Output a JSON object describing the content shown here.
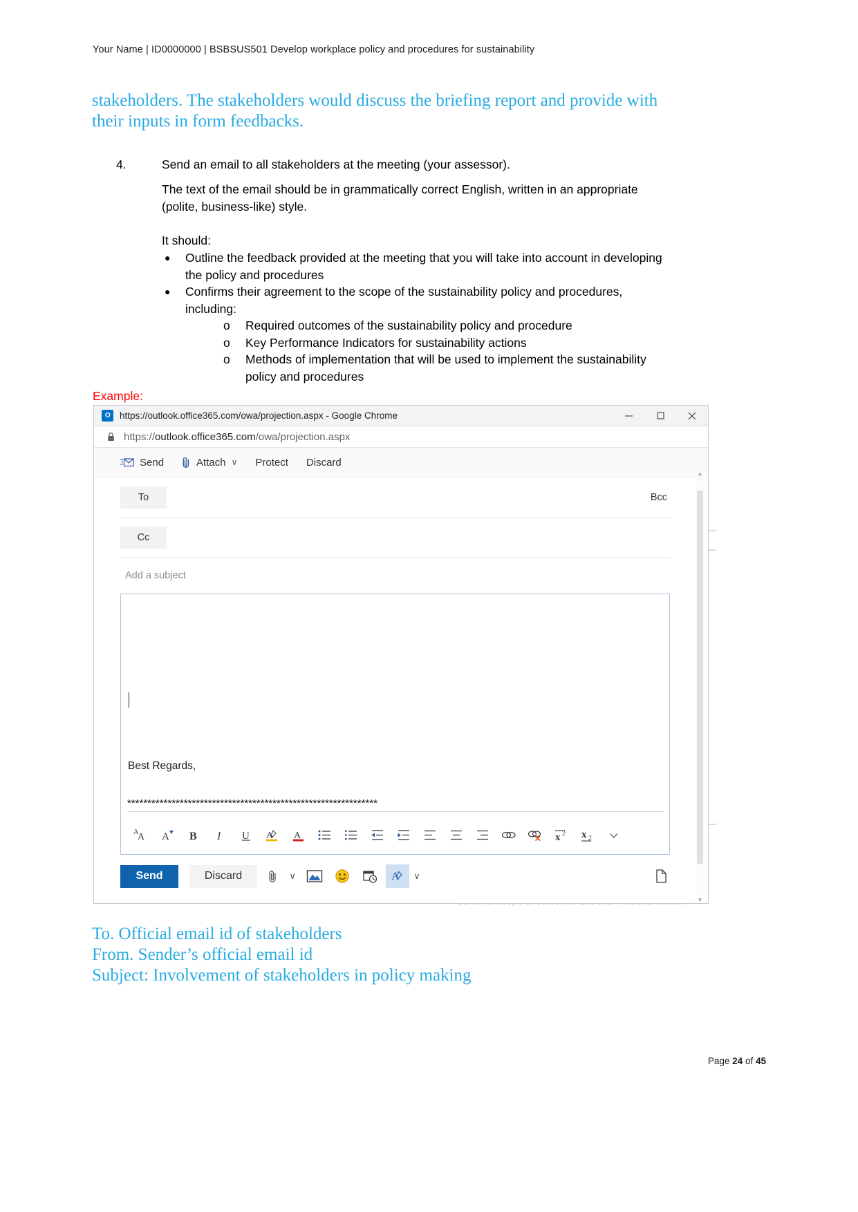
{
  "document": {
    "header": "Your Name | ID0000000 | BSBSUS501 Develop workplace policy and procedures for sustainability",
    "intro_paragraph": "stakeholders. The stakeholders would discuss the briefing report and provide with their inputs in form feedbacks.",
    "task": {
      "number": "4.",
      "text": "Send an email to all stakeholders at the meeting (your assessor).",
      "style_note": "The text of the email should be in grammatically correct English, written in an appropriate (polite, business-like) style.",
      "it_should": "It should:",
      "bullets": [
        {
          "text": "Outline the feedback provided at the meeting that you will take into account in developing the policy and procedures",
          "sub": []
        },
        {
          "text": "Confirms their agreement to the scope of the sustainability policy and procedures, including:",
          "sub": [
            "Required outcomes of the sustainability policy and procedure",
            "Key Performance Indicators for sustainability actions",
            "Methods of implementation that will be used to implement the sustainability policy and procedures"
          ]
        }
      ]
    },
    "example_label": "Example:",
    "closing_lines": [
      "To. Official email id of stakeholders",
      "From. Sender’s official email id",
      "Subject: Involvement of stakeholders in policy making"
    ],
    "footer": {
      "prefix": "Page ",
      "page": "24",
      "middle": " of ",
      "total": "45"
    },
    "ghost_text": "Confirms  scope to  outcome   Australian  national carbon"
  },
  "browser": {
    "favicon_label": "O",
    "title": "https://outlook.office365.com/owa/projection.aspx - Google Chrome",
    "controls": {
      "minimize": "—",
      "maximize": "□",
      "close": "✕"
    },
    "omnibox": {
      "scheme": "https://",
      "host": "outlook.office365.com",
      "path": "/owa/projection.aspx",
      "full_url": "https://outlook.office365.com/owa/projection.aspx"
    }
  },
  "compose": {
    "toolbar": [
      {
        "label": "Send",
        "icon": "send-mail-icon",
        "caret": false
      },
      {
        "label": "Attach",
        "icon": "paperclip-icon",
        "caret": true
      },
      {
        "label": "Protect",
        "icon": "",
        "caret": false
      },
      {
        "label": "Discard",
        "icon": "",
        "caret": false
      }
    ],
    "to_label": "To",
    "cc_label": "Cc",
    "bcc_label": "Bcc",
    "to_value": "",
    "cc_value": "",
    "subject_placeholder": "Add a subject",
    "subject_value": "",
    "body_signoff": "Best Regards,",
    "body_separator": "**************************************************************",
    "format_buttons": [
      "font-size-grow-icon",
      "font-color-picker-icon",
      "bold-icon",
      "italic-icon",
      "underline-icon",
      "highlight-icon",
      "font-color-icon",
      "bulleted-list-icon",
      "numbered-list-icon",
      "decrease-indent-icon",
      "increase-indent-icon",
      "align-left-icon",
      "align-center-icon",
      "align-right-icon",
      "insert-link-icon",
      "remove-link-icon",
      "superscript-icon",
      "subscript-icon",
      "chevron-down-icon"
    ],
    "actions": {
      "send_label": "Send",
      "discard_label": "Discard",
      "icons": [
        "paperclip-icon",
        "chevron-down-icon",
        "insert-picture-icon",
        "emoji-icon",
        "schedule-icon",
        "formatting-icon",
        "chevron-down-icon"
      ],
      "popout_icon": "pop-out-icon"
    }
  },
  "colors": {
    "accent_blue": "#29ABE2",
    "send_button": "#0f62ac",
    "example_red": "#FF0000",
    "favicon": "#0072C6"
  }
}
